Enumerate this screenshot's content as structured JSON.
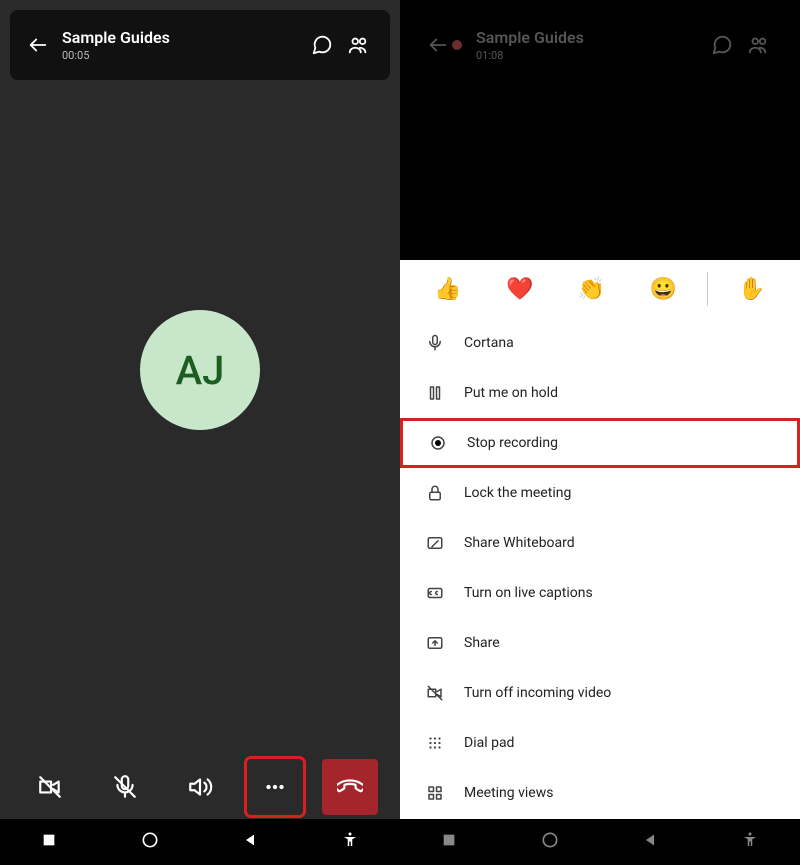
{
  "left": {
    "title": "Sample Guides",
    "timer": "00:05",
    "avatar_initials": "AJ",
    "nav": [
      "square",
      "circle",
      "triangle",
      "person"
    ]
  },
  "right": {
    "title": "Sample Guides",
    "timer": "01:08",
    "reactions": [
      "👍",
      "❤️",
      "👏",
      "😀",
      "✋"
    ],
    "menu": [
      {
        "icon": "mic",
        "label": "Cortana"
      },
      {
        "icon": "pause",
        "label": "Put me on hold"
      },
      {
        "icon": "record",
        "label": "Stop recording",
        "highlighted": true
      },
      {
        "icon": "lock",
        "label": "Lock the meeting"
      },
      {
        "icon": "whiteboard",
        "label": "Share Whiteboard"
      },
      {
        "icon": "cc",
        "label": "Turn on live captions"
      },
      {
        "icon": "share",
        "label": "Share"
      },
      {
        "icon": "video-off",
        "label": "Turn off incoming video"
      },
      {
        "icon": "dialpad",
        "label": "Dial pad"
      },
      {
        "icon": "grid",
        "label": "Meeting views"
      }
    ]
  }
}
